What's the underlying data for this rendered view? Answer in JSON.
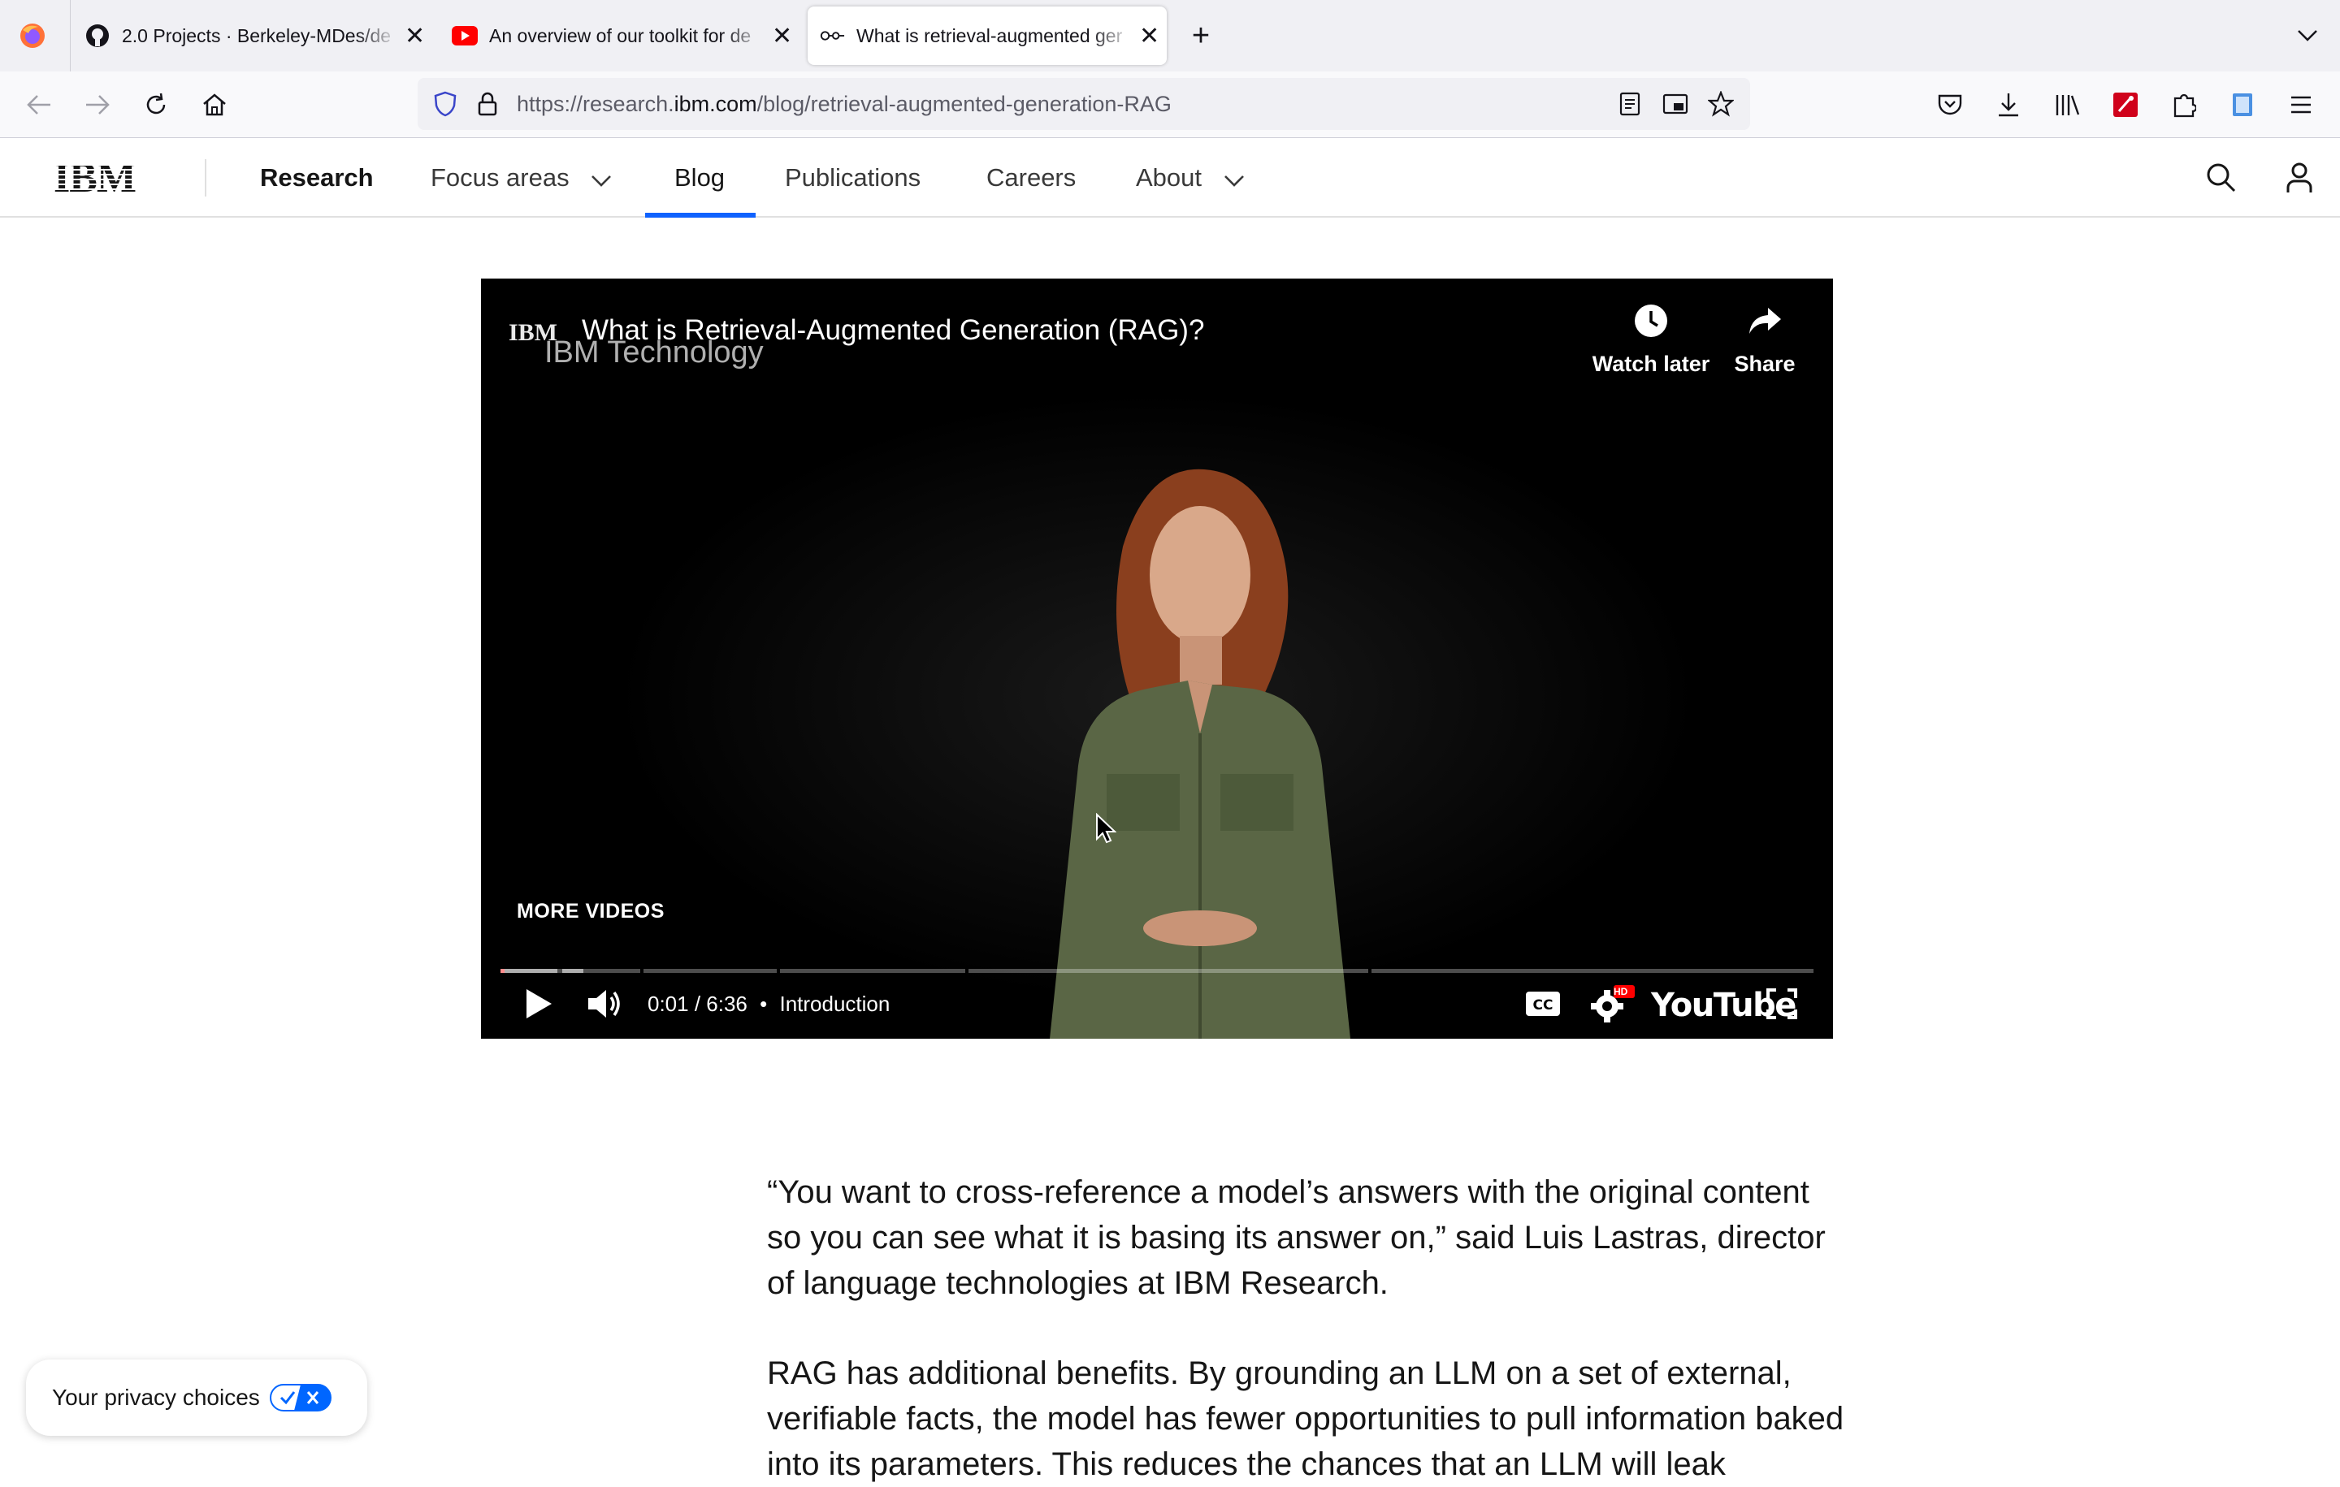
{
  "browser": {
    "tabs": [
      {
        "title": "2.0 Projects · Berkeley-MDes/de",
        "favicon": "github-icon"
      },
      {
        "title": "An overview of our toolkit for de",
        "favicon": "youtube-icon"
      },
      {
        "title": "What is retrieval-augmented ger",
        "favicon": "ibm-research-icon",
        "active": true
      }
    ],
    "url_prefix": "https://research.",
    "url_domain": "ibm.com",
    "url_path": "/blog/retrieval-augmented-generation-RAG"
  },
  "site_nav": {
    "logo": "IBM",
    "research": "Research",
    "focus_areas": "Focus areas",
    "blog": "Blog",
    "publications": "Publications",
    "careers": "Careers",
    "about": "About"
  },
  "video": {
    "channel_badge": "IBM",
    "title": "What is Retrieval-Augmented Generation (RAG)?",
    "channel": "IBM Technology",
    "watch_later": "Watch later",
    "share": "Share",
    "more_videos": "MORE VIDEOS",
    "time": "0:01 / 6:36",
    "chapter": "Introduction",
    "youtube": "YouTube",
    "quality_badge": "HD",
    "progress_fraction": 0.003
  },
  "article": {
    "paragraph1": "“You want to cross-reference a model’s answers with the original content so you can see what it is basing its answer on,” said Luis Lastras, director of language technologies at IBM Research.",
    "paragraph2": "RAG has additional benefits. By grounding an LLM on a set of external, verifiable facts, the model has fewer opportunities to pull information baked into its parameters. This reduces the chances that an LLM will leak"
  },
  "privacy": {
    "label": "Your privacy choices"
  }
}
